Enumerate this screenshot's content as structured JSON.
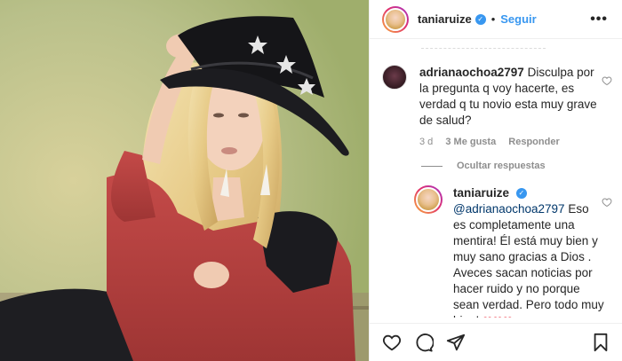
{
  "header": {
    "username": "taniaruize",
    "verified_mark": "✓",
    "separator": "•",
    "follow_label": "Seguir",
    "more_icon": "•••"
  },
  "comment": {
    "username": "adrianaochoa2797",
    "text": "Disculpa por la pregunta q voy hacerte, es verdad q tu novio esta muy grave de salud?",
    "age": "3 d",
    "likes": "3 Me gusta",
    "reply_label": "Responder"
  },
  "hide_replies_label": "Ocultar respuestas",
  "reply": {
    "username": "taniaruize",
    "verified_mark": "✓",
    "mention": "@adrianaochoa2797",
    "text": " Eso es completamente una mentira! Él está muy bien y muy sano gracias a Dios . Aveces sacan noticias por hacer ruido y no porque sean verdad. Pero todo muy bien! ",
    "hearts": "❤❤❤"
  },
  "icons": {
    "heart": "heart-icon",
    "comment": "comment-icon",
    "share": "share-icon",
    "save": "bookmark-icon",
    "small_heart": "heart-outline-icon"
  },
  "colors": {
    "link": "#3897f0",
    "muted": "#8e8e8e",
    "text": "#262626",
    "heart_red": "#ed4956",
    "jacket": "#b8403f"
  }
}
